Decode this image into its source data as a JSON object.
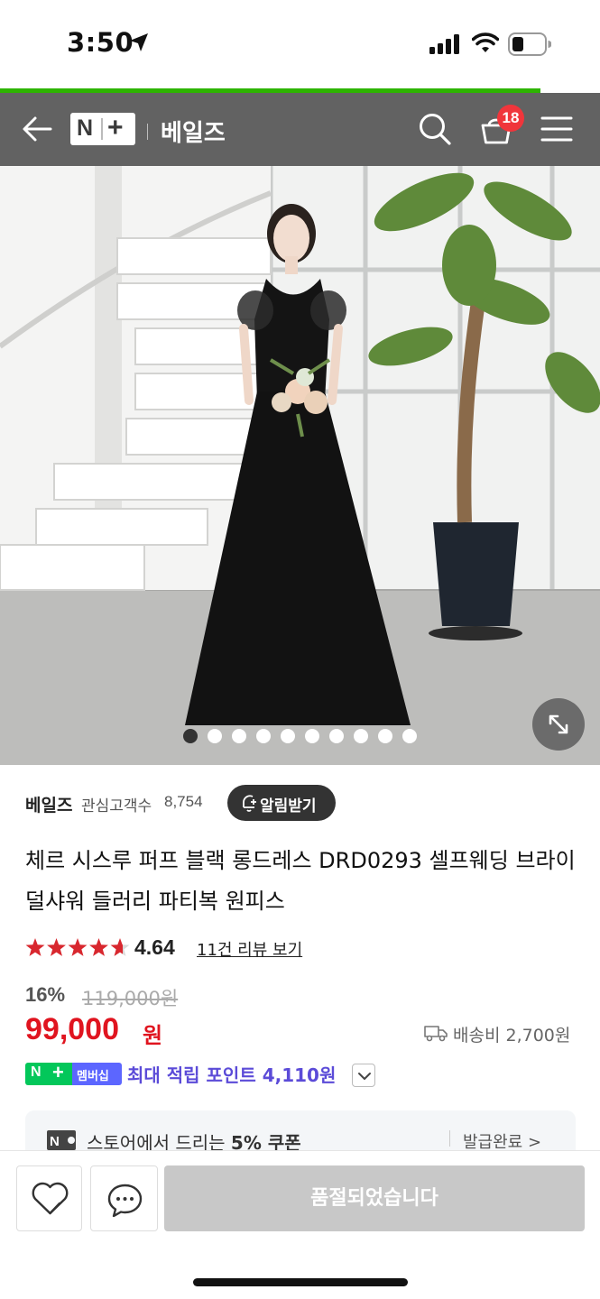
{
  "status_bar": {
    "time": "3:50"
  },
  "load_progress": 0.9,
  "nav": {
    "logo_n": "N",
    "logo_plus": "+",
    "store_name": "베일즈",
    "cart_count": "18"
  },
  "gallery": {
    "image_count": 10,
    "active_index": 0
  },
  "store": {
    "name": "베일즈",
    "fan_label": "관심고객수",
    "fan_count": "8,754",
    "notify_label": "알림받기"
  },
  "product": {
    "title": "체르 시스루 퍼프 블랙 롱드레스 DRD0293 셀프웨딩 브라이덜샤워 들러리 파티복 원피스",
    "rating": 4.64,
    "rating_text": "4.64",
    "review_link": "11건 리뷰 보기",
    "discount_rate": "16%",
    "original_price": "119,000원",
    "sale_price": "99,000",
    "sale_unit": "원",
    "shipping": "배송비 2,700원"
  },
  "membership": {
    "badge_n": "N",
    "badge_plus": "+",
    "badge_label": "멤버십",
    "points_text": "최대 적립 포인트 4,110원"
  },
  "coupon": {
    "text_prefix": "스토어에서 드리는 ",
    "text_bold": "5% 쿠폰",
    "status": "발급완료 >"
  },
  "bottom_bar": {
    "soldout_label": "품절되었습니다"
  },
  "colors": {
    "nav_bg": "#626262",
    "progress": "#2db400",
    "price_red": "#e0141f",
    "member_purple": "#5b4bd8",
    "member_green": "#03c75a",
    "badge_red": "#f0353b"
  }
}
